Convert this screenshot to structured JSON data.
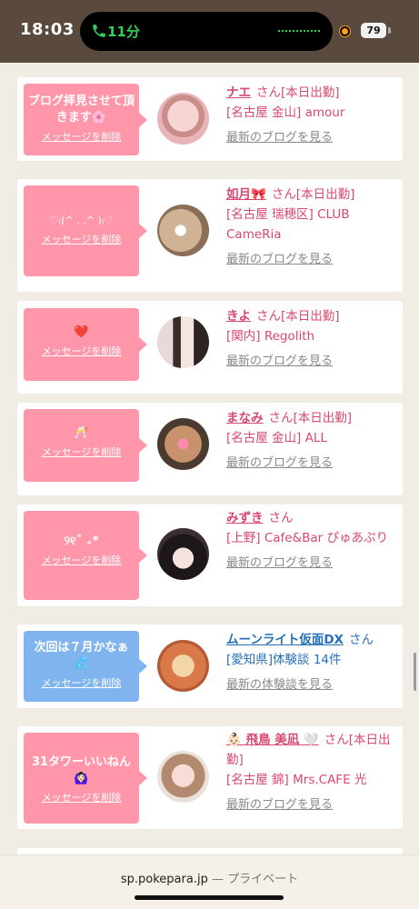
{
  "status": {
    "time": "18:03",
    "call_duration": "11分",
    "battery": "79"
  },
  "cards": [
    {
      "message": "ブログ拝見させて頂きます🌸",
      "delete_label": "メッセージを削除",
      "name": "ナエ",
      "suffix": "さん[本日出勤]",
      "shop": "[名古屋 金山] amour",
      "link": "最新のブログを見る",
      "bubble_color": "#ff96aa",
      "avatar": "avatar-pink"
    },
    {
      "message": "♡₍(^ . .^ )₎♡",
      "delete_label": "メッセージを削除",
      "name": "如月🎀",
      "suffix": "さん[本日出勤]",
      "shop": "[名古屋 瑞穂区] CLUB CameRia",
      "link": "最新のブログを見る",
      "bubble_color": "#ff96aa",
      "avatar": "avatar-heart"
    },
    {
      "message": "❤️",
      "delete_label": "メッセージを削除",
      "name": "きよ",
      "suffix": "さん[本日出勤]",
      "shop": "[関内] Regolith",
      "link": "最新のブログを見る",
      "bubble_color": "#ff96aa",
      "avatar": "avatar-group"
    },
    {
      "message": "🥂",
      "delete_label": "メッセージを削除",
      "name": "まなみ",
      "suffix": "さん[本日出勤]",
      "shop": "[名古屋 金山] ALL",
      "link": "最新のブログを見る",
      "bubble_color": "#ff96aa",
      "avatar": "avatar-flower"
    },
    {
      "message": "୨୧˚ ₊*",
      "delete_label": "メッセージを削除",
      "name": "みずき",
      "suffix": "さん",
      "shop": "[上野] Cafe&Bar ぴゅあぷり",
      "link": "最新のブログを見る",
      "bubble_color": "#ff96aa",
      "avatar": "avatar-maid"
    },
    {
      "message": "次回は７月かなぁ💦",
      "delete_label": "メッセージを削除",
      "name": "ムーンライト仮面DX",
      "suffix": "さん",
      "shop": "[愛知県]体験談 14件",
      "link": "最新の体験談を見る",
      "bubble_color": "#7fb4ef",
      "avatar": "avatar-bear"
    },
    {
      "message": "31タワーいいねん🙆🏻‍♀️",
      "delete_label": "メッセージを削除",
      "name": "👶🏻 飛鳥 美凪 🤍",
      "suffix": "さん[本日出勤]",
      "shop": "[名古屋 錦] Mrs.CAFE 光",
      "link": "最新のブログを見る",
      "bubble_color": "#ff96aa",
      "avatar": "avatar-woman"
    }
  ],
  "browser": {
    "domain": "sp.pokepara.jp",
    "separator": " — ",
    "mode": "プライベート"
  }
}
